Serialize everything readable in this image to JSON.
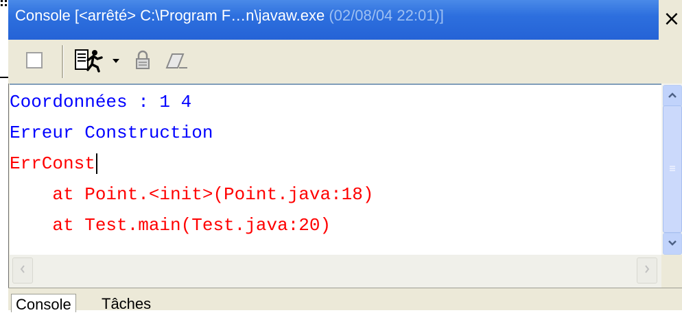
{
  "window": {
    "title": "Console [<arrêté> C:\\Program F…n\\javaw.exe ",
    "title_timestamp": "(02/08/04 22:01)]",
    "close_label": "×"
  },
  "toolbar": {
    "buttons": [
      {
        "name": "clear-console-icon"
      },
      {
        "name": "run-menu-icon"
      },
      {
        "name": "dropdown-arrow-icon"
      },
      {
        "name": "scroll-lock-icon"
      },
      {
        "name": "erase-icon"
      }
    ]
  },
  "console": {
    "lines": [
      {
        "text": "Coordonnées : 1 4",
        "color": "#0000ff"
      },
      {
        "text": "Erreur Construction",
        "color": "#0000ff"
      },
      {
        "text": "ErrConst",
        "color": "#ff0000"
      },
      {
        "text": "    at Point.<init>(Point.java:18)",
        "color": "#ff0000"
      },
      {
        "text": "    at Test.main(Test.java:20)",
        "color": "#ff0000"
      }
    ]
  },
  "tabs": [
    {
      "label": "Console",
      "active": true
    },
    {
      "label": "Tâches",
      "active": false
    }
  ],
  "colors": {
    "title_bar": "#2d6fde",
    "stdout": "#0000ff",
    "stderr": "#ff0000"
  }
}
